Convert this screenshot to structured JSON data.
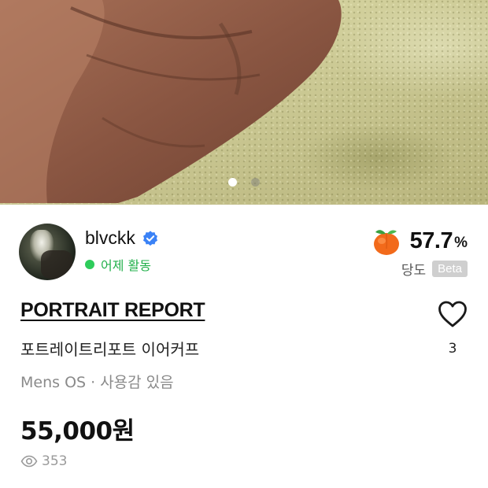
{
  "carousel": {
    "total_images": 2,
    "active_index": 0
  },
  "seller": {
    "name": "blvckk",
    "verified": true,
    "activity": "어제 활동"
  },
  "sweetness": {
    "value": "57.7",
    "unit": "%",
    "label": "당도",
    "badge": "Beta"
  },
  "product": {
    "brand": "PORTRAIT REPORT",
    "title": "포트레이트리포트 이어커프",
    "meta": "Mens OS · 사용감 있음",
    "price": "55,000원",
    "views": "353"
  },
  "likes": {
    "count": "3"
  },
  "colors": {
    "activity_green": "#22b04b",
    "verified_blue": "#3b82f6",
    "peach_orange": "#f26a1b"
  }
}
